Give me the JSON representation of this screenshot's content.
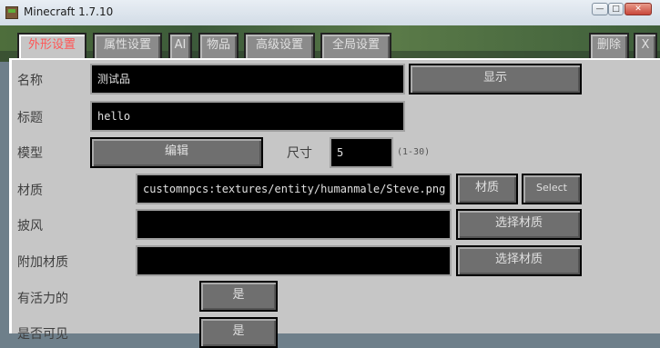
{
  "window": {
    "title": "Minecraft 1.7.10"
  },
  "tabs": [
    {
      "label": "外形设置",
      "active": true
    },
    {
      "label": "属性设置"
    },
    {
      "label": "AI"
    },
    {
      "label": "物品"
    },
    {
      "label": "高级设置"
    },
    {
      "label": "全局设置"
    },
    {
      "label": "删除"
    },
    {
      "label": "X"
    }
  ],
  "form": {
    "name_label": "名称",
    "name_value": "测试品",
    "show_button": "显示",
    "title_label": "标题",
    "title_value": "hello",
    "model_label": "模型",
    "model_button": "编辑",
    "size_label": "尺寸",
    "size_value": "5",
    "size_range": "(1-30)",
    "texture_label": "材质",
    "texture_value": "customnpcs:textures/entity/humanmale/Steve.png",
    "texture_button": "材质",
    "select_button": "Select",
    "cape_label": "披风",
    "cape_value": "",
    "cape_button": "选择材质",
    "overlay_label": "附加材质",
    "overlay_value": "",
    "overlay_button": "选择材质",
    "lively_label": "有活力的",
    "lively_button": "是",
    "visible_label": "是否可见",
    "visible_button": "是"
  }
}
